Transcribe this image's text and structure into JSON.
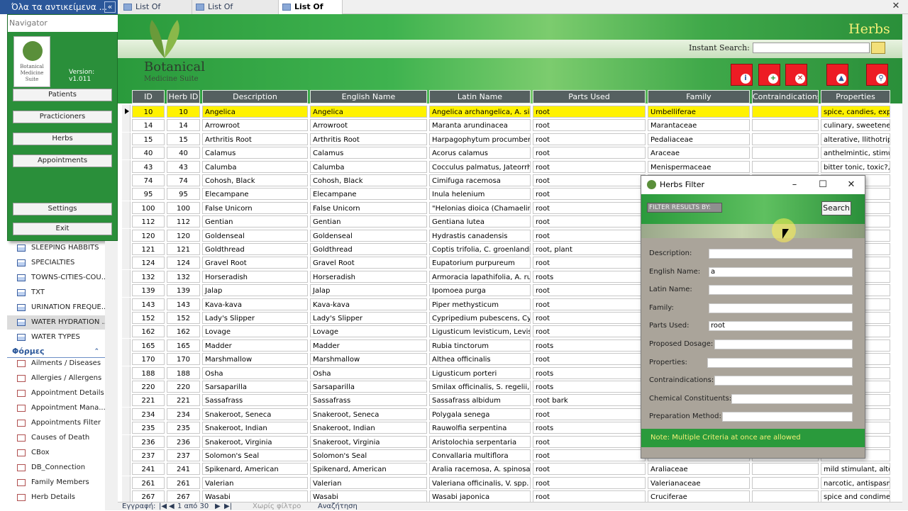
{
  "tabs": {
    "nav_selector": "Όλα τα αντικείμενα ...",
    "items": [
      {
        "label": "List Of Patients"
      },
      {
        "label": "List Of Practicioners"
      },
      {
        "label": "List Of Herbs"
      }
    ]
  },
  "navigator": {
    "title": "Navigator",
    "logo_text": "Botanical Medicine Suite",
    "version": "Version:  v1.011",
    "buttons": [
      "Patients",
      "Practicioners",
      "Herbs",
      "Appointments",
      "Settings",
      "Exit"
    ]
  },
  "objects": {
    "tables": [
      "SLEEPING HABBITS",
      "SPECIALTIES",
      "TOWNS-CITIES-COU...",
      "TXT",
      "URINATION FREQUE...",
      "WATER HYDRATION ...",
      "WATER TYPES"
    ],
    "forms_group_label": "Φόρμες",
    "forms": [
      "Ailments / Diseases",
      "Allergies / Allergens",
      "Appointment Details",
      "Appointment Mana...",
      "Appointments Filter",
      "Causes of Death",
      "CBox",
      "DB_Connection",
      "Family Members",
      "Herb Details"
    ]
  },
  "banner": {
    "brand": "Botanical",
    "brand_sub": "Medicine Suite",
    "title": "Herbs",
    "instant_search_label": "Instant Search:",
    "instant_search_value": ""
  },
  "table": {
    "headers": [
      "ID",
      "Herb ID",
      "Description",
      "English Name",
      "Latin Name",
      "Parts Used",
      "Family",
      "Contraindications",
      "Properties"
    ],
    "rows": [
      [
        "10",
        "10",
        "Angelica",
        "Angelica",
        "Angelica archangelica, A. sin",
        "root",
        "Umbelliferae",
        "",
        "spice, candies, expe"
      ],
      [
        "14",
        "14",
        "Arrowroot",
        "Arrowroot",
        "Maranta arundinacea",
        "root",
        "Marantaceae",
        "",
        "culinary, sweetener"
      ],
      [
        "15",
        "15",
        "Arthritis Root",
        "Arthritis Root",
        "Harpagophytum procumbens",
        "root",
        "Pedaliaceae",
        "",
        "alterative, llithotrip"
      ],
      [
        "40",
        "40",
        "Calamus",
        "Calamus",
        "Acorus calamus",
        "root",
        "Araceae",
        "",
        "anthelmintic, stimu"
      ],
      [
        "43",
        "43",
        "Calumba",
        "Calumba",
        "Cocculus palmatus, Jateorrhi",
        "root",
        "Menispermaceae",
        "",
        "bitter tonic, toxic?, s"
      ],
      [
        "74",
        "74",
        "Cohosh, Black",
        "Cohosh, Black",
        "Cimifuga racemosa",
        "root",
        "",
        "",
        "tter ast"
      ],
      [
        "95",
        "95",
        "Elecampane",
        "Elecampane",
        "Inula helenium",
        "root",
        "",
        "",
        "expect"
      ],
      [
        "100",
        "100",
        "False Unicorn",
        "False Unicorn",
        "\"Helonias dioica (Chamaelir",
        "root",
        "",
        "",
        ""
      ],
      [
        "112",
        "112",
        "Gentian",
        "Gentian",
        "Gentiana lutea",
        "root",
        "",
        "",
        "stomac"
      ],
      [
        "120",
        "120",
        "Goldenseal",
        "Goldenseal",
        "Hydrastis canadensis",
        "root",
        "",
        "",
        "emosta"
      ],
      [
        "121",
        "121",
        "Goldthread",
        "Goldthread",
        "Coptis trifolia, C. groenlandic",
        "root, plant",
        "",
        "",
        "oral he"
      ],
      [
        "124",
        "124",
        "Gravel Root",
        "Gravel Root",
        "Eupatorium purpureum",
        "root",
        "",
        "",
        "antilit"
      ],
      [
        "132",
        "132",
        "Horseradish",
        "Horseradish",
        "Armoracia lapathifolia, A. rus",
        "roots",
        "",
        "",
        "diapho"
      ],
      [
        "139",
        "139",
        "Jalap",
        "Jalap",
        "Ipomoea purga",
        "root",
        "",
        "",
        "ative"
      ],
      [
        "143",
        "143",
        "Kava-kava",
        "Kava-kava",
        "Piper methysticum",
        "root",
        "",
        "",
        "a, or na"
      ],
      [
        "152",
        "152",
        "Lady's Slipper",
        "Lady's Slipper",
        "Cypripedium pubescens, Cyp",
        "root",
        "",
        "",
        "spasm"
      ],
      [
        "162",
        "162",
        "Lovage",
        "Lovage",
        "Ligusticum levisticum, Levisti",
        "root",
        "",
        "",
        "ant, car"
      ],
      [
        "165",
        "165",
        "Madder",
        "Madder",
        "Rubia tinctorum",
        "roots",
        "",
        "",
        "on dye"
      ],
      [
        "170",
        "170",
        "Marshmallow",
        "Marshmallow",
        "Althea officinalis",
        "root",
        "",
        "",
        "emolli"
      ],
      [
        "188",
        "188",
        "Osha",
        "Osha",
        "Ligusticum porteri",
        "roots",
        "",
        "",
        "espirat"
      ],
      [
        "220",
        "220",
        "Sarsaparilla",
        "Sarsaparilla",
        "Smilax officinalis, S. regelii, S",
        "roots",
        "",
        "",
        "ale ho"
      ],
      [
        "221",
        "221",
        "Sassafrass",
        "Sassafrass",
        "Sassafrass albidum",
        "root bark",
        "",
        "",
        "onic, alt"
      ],
      [
        "234",
        "234",
        "Snakeroot, Seneca",
        "Snakeroot, Seneca",
        "Polygala senega",
        "root",
        "",
        "",
        "xpecto"
      ],
      [
        "235",
        "235",
        "Snakeroot, Indian",
        "Snakeroot, Indian",
        "Rauwolfia serpentina",
        "roots",
        "",
        "",
        "uilizer,"
      ],
      [
        "236",
        "236",
        "Snakeroot, Virginia",
        "Snakeroot, Virginia",
        "Aristolochia serpentaria",
        "root",
        "",
        "",
        "ker, sna"
      ],
      [
        "237",
        "237",
        "Solomon's Seal",
        "Solomon's Seal",
        "Convallaria multiflora",
        "root",
        "",
        "",
        "cent, a"
      ],
      [
        "241",
        "241",
        "Spikenard, American",
        "Spikenard, American",
        "Aralia racemosa, A. spinosa",
        "root",
        "Araliaceae",
        "",
        "mild stimulant, alte"
      ],
      [
        "261",
        "261",
        "Valerian",
        "Valerian",
        "Valeriana officinalis, V. spp.",
        "root",
        "Valerianaceae",
        "",
        "narcotic, antispasm"
      ],
      [
        "267",
        "267",
        "Wasabi",
        "Wasabi",
        "Wasabi japonica",
        "root",
        "Cruciferae",
        "",
        "spice and condimer"
      ]
    ]
  },
  "statusbar": {
    "record_label": "Εγγραφή:",
    "position": "1 από 30",
    "filter": "Χωρίς φίλτρο",
    "search": "Αναζήτηση"
  },
  "filter_dialog": {
    "title": "Herbs Filter",
    "filter_label": "FILTER RESULTS BY:",
    "search_button": "Search",
    "fields": [
      {
        "label": "Description:",
        "value": ""
      },
      {
        "label": "English Name:",
        "value": "a"
      },
      {
        "label": "Latin Name:",
        "value": ""
      },
      {
        "label": "Family:",
        "value": ""
      },
      {
        "label": "Parts Used:",
        "value": "root"
      },
      {
        "label": "Proposed Dosage:",
        "value": ""
      },
      {
        "label": "Properties:",
        "value": ""
      },
      {
        "label": "Contraindications:",
        "value": ""
      },
      {
        "label": "Chemical Constituents:",
        "value": ""
      },
      {
        "label": "Preparation Method:",
        "value": ""
      }
    ],
    "note": "Note: Multiple Criteria at once are allowed"
  },
  "colors": {
    "brand_green": "#2a9a3c",
    "selected_row": "#fff200",
    "header_gray": "#556060",
    "title_yellow": "#f4f078"
  }
}
